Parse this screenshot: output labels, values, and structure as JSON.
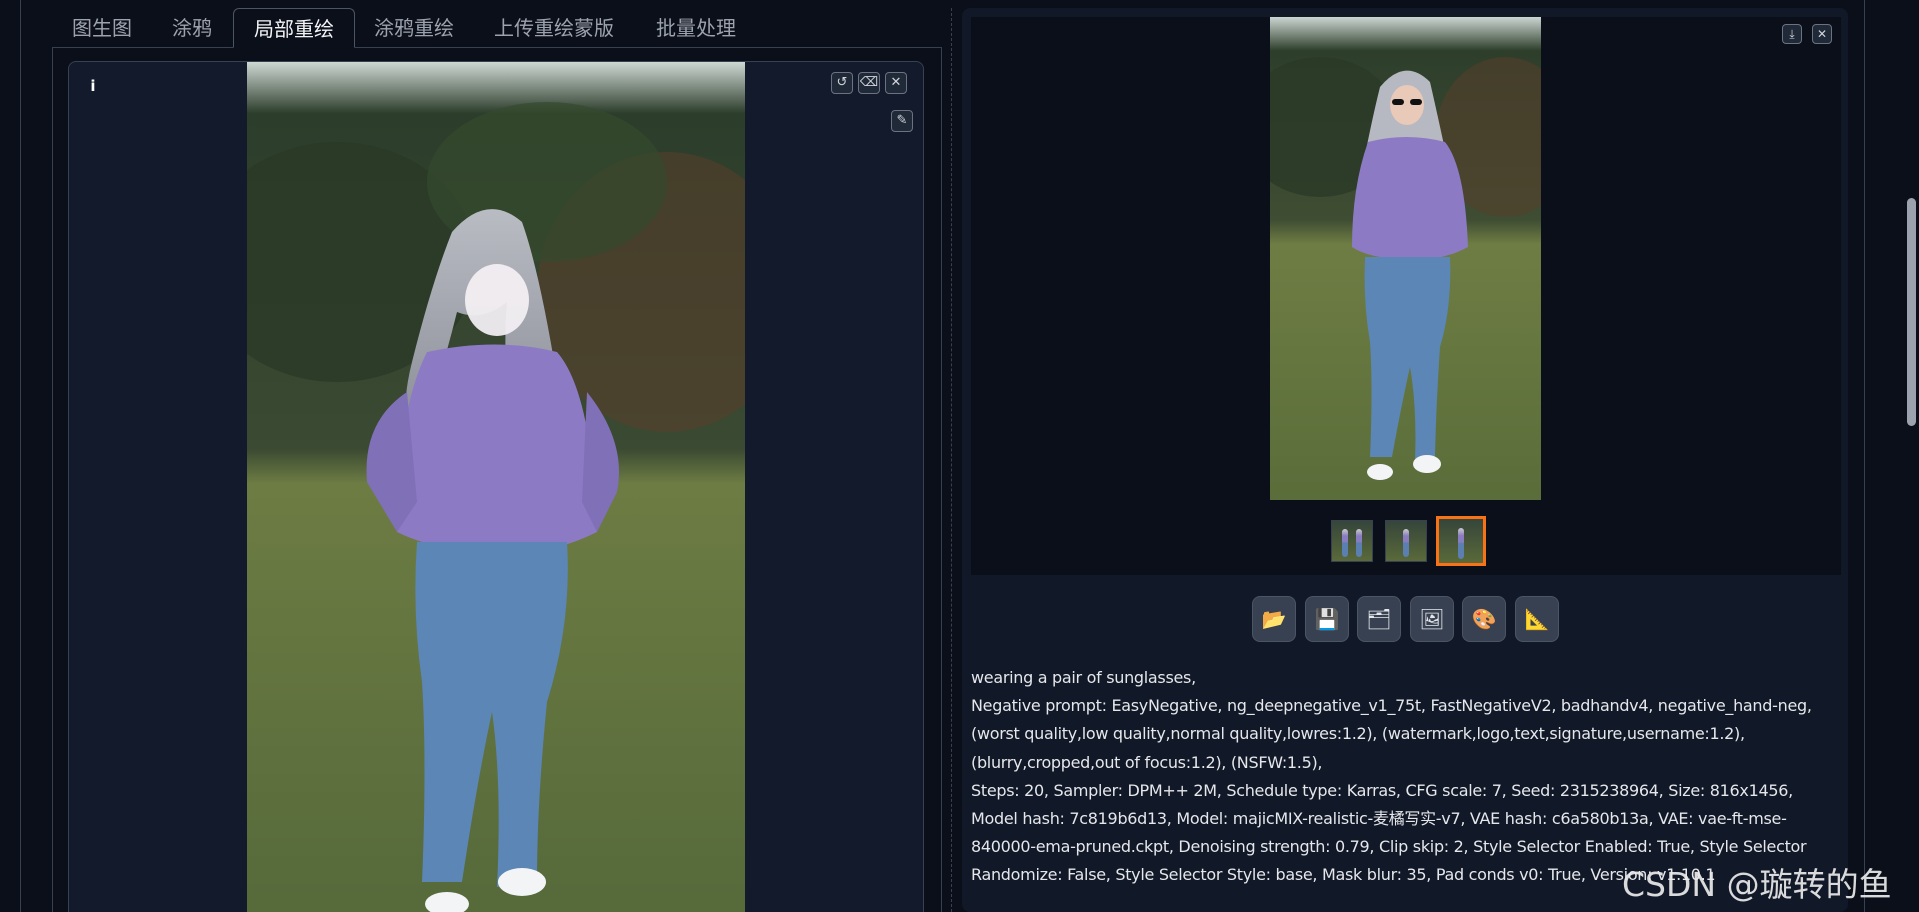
{
  "tabs": [
    {
      "label": "图生图"
    },
    {
      "label": "涂鸦"
    },
    {
      "label": "局部重绘"
    },
    {
      "label": "涂鸦重绘"
    },
    {
      "label": "上传重绘蒙版"
    },
    {
      "label": "批量处理"
    }
  ],
  "active_tab": "局部重绘",
  "editor": {
    "info_icon": "info-icon",
    "buttons": [
      {
        "name": "undo-button",
        "icon": "undo-icon",
        "glyph": "↺"
      },
      {
        "name": "clear-button",
        "icon": "eraser-icon",
        "glyph": "⌫"
      },
      {
        "name": "close-button",
        "icon": "close-icon",
        "glyph": "✕"
      },
      {
        "name": "brush-button",
        "icon": "brush-icon",
        "glyph": "✎"
      }
    ]
  },
  "output": {
    "top_buttons": [
      {
        "name": "download-button",
        "icon": "download-icon",
        "glyph": "⤓"
      },
      {
        "name": "close-output-button",
        "icon": "close-icon",
        "glyph": "✕"
      }
    ],
    "thumbnails": 3,
    "selected_thumbnail": 3,
    "action_buttons": [
      {
        "name": "open-folder-button",
        "icon": "folder-icon",
        "glyph": "📂"
      },
      {
        "name": "save-button",
        "icon": "floppy-icon",
        "glyph": "💾"
      },
      {
        "name": "zip-button",
        "icon": "zip-icon",
        "glyph": "🗂"
      },
      {
        "name": "send-to-img2img-button",
        "icon": "picture-icon",
        "glyph": "🖼"
      },
      {
        "name": "send-to-inpaint-button",
        "icon": "palette-icon",
        "glyph": "🎨"
      },
      {
        "name": "send-to-extras-button",
        "icon": "triangle-ruler-icon",
        "glyph": "📐"
      }
    ],
    "info_lines": [
      "wearing a pair of sunglasses,",
      "Negative prompt: EasyNegative, ng_deepnegative_v1_75t, FastNegativeV2, badhandv4, negative_hand-neg, (worst quality,low quality,normal quality,lowres:1.2), (watermark,logo,text,signature,username:1.2), (blurry,cropped,out of focus:1.2), (NSFW:1.5),",
      "Steps: 20, Sampler: DPM++ 2M, Schedule type: Karras, CFG scale: 7, Seed: 2315238964, Size: 816x1456, Model hash: 7c819b6d13, Model: majicMIX-realistic-麦橘写实-v7, VAE hash: c6a580b13a, VAE: vae-ft-mse-840000-ema-pruned.ckpt, Denoising strength: 0.79, Clip skip: 2, Style Selector Enabled: True, Style Selector Randomize: False, Style Selector Style: base, Mask blur: 35, Pad conds v0: True, Version: v1.10.1"
    ]
  },
  "watermark": "CSDN @璇转的鱼"
}
